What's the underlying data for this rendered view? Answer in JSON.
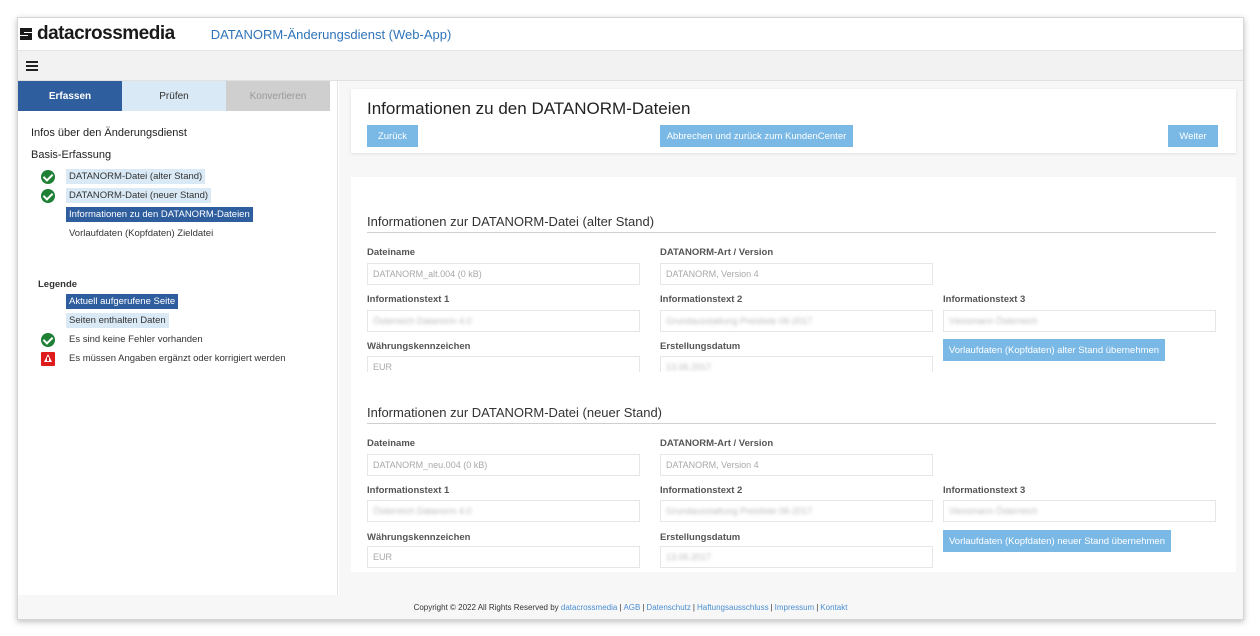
{
  "header": {
    "logo_dark": "data",
    "logo_blue": "crossmedia",
    "app_title": "DATANORM-Änderungsdienst (Web-App)"
  },
  "toolbar": {
    "menu_icon": "hamburger-icon"
  },
  "sidebar": {
    "tabs": [
      {
        "label": "Erfassen",
        "state": "active"
      },
      {
        "label": "Prüfen",
        "state": "normal"
      },
      {
        "label": "Konvertieren",
        "state": "disabled"
      }
    ],
    "info_heading": "Infos über den Änderungsdienst",
    "basis_heading": "Basis-Erfassung",
    "steps": [
      {
        "label": "DATANORM-Datei (alter Stand)",
        "icon": "check-icon",
        "style": "data"
      },
      {
        "label": "DATANORM-Datei (neuer Stand)",
        "icon": "check-icon",
        "style": "data"
      },
      {
        "label": "Informationen zu den DATANORM-Dateien",
        "icon": "",
        "style": "current"
      },
      {
        "label": "Vorlaufdaten (Kopfdaten) Zieldatei",
        "icon": "",
        "style": "plain"
      }
    ],
    "legend": {
      "title": "Legende",
      "items": [
        {
          "label": "Aktuell aufgerufene Seite",
          "style": "current"
        },
        {
          "label": "Seiten enthalten Daten",
          "style": "data"
        },
        {
          "label": "Es sind keine Fehler vorhanden",
          "icon": "check-icon"
        },
        {
          "label": "Es müssen Angaben ergänzt oder korrigiert werden",
          "icon": "warning-icon"
        }
      ]
    }
  },
  "page": {
    "title": "Informationen zu den DATANORM-Dateien",
    "back_button": "Zurück",
    "cancel_button": "Abbrechen und zurück zum KundenCenter",
    "next_button": "Weiter"
  },
  "old": {
    "heading": "Informationen zur DATANORM-Datei (alter Stand)",
    "dateiname_label": "Dateiname",
    "dateiname_value": "DATANORM_alt.004 (0 kB)",
    "art_label": "DATANORM-Art / Version",
    "art_value": "DATANORM, Version 4",
    "info1_label": "Informationstext 1",
    "info1_value": "Österreich Datanorm 4.0",
    "info2_label": "Informationstext 2",
    "info2_value": "Grundausstattung Preisliste 06-2017",
    "info3_label": "Informationstext 3",
    "info3_value": "Viessmann Österreich",
    "currency_label": "Währungskennzeichen",
    "currency_value": "EUR",
    "date_label": "Erstellungsdatum",
    "date_value": "13.06.2017",
    "apply_button": "Vorlaufdaten (Kopfdaten) alter Stand übernehmen"
  },
  "new": {
    "heading": "Informationen zur DATANORM-Datei (neuer Stand)",
    "dateiname_label": "Dateiname",
    "dateiname_value": "DATANORM_neu.004 (0 kB)",
    "art_label": "DATANORM-Art / Version",
    "art_value": "DATANORM, Version 4",
    "info1_label": "Informationstext 1",
    "info1_value": "Österreich Datanorm 4.0",
    "info2_label": "Informationstext 2",
    "info2_value": "Grundausstattung Preisliste 06-2017",
    "info3_label": "Informationstext 3",
    "info3_value": "Viessmann Österreich",
    "currency_label": "Währungskennzeichen",
    "currency_value": "EUR",
    "date_label": "Erstellungsdatum",
    "date_value": "13.06.2017",
    "apply_button": "Vorlaufdaten (Kopfdaten) neuer Stand übernehmen"
  },
  "footer": {
    "copyright": "Copyright © 2022 All Rights Reserved by",
    "links": [
      "datacrossmedia",
      "AGB",
      "Datenschutz",
      "Haftungsausschluss",
      "Impressum",
      "Kontakt"
    ]
  },
  "colors": {
    "brand_blue": "#2f74b9",
    "active_tab": "#2f5e9e",
    "button": "#7ab8e6",
    "check_green": "#1e7f35",
    "warning_red": "#e01b1b"
  }
}
